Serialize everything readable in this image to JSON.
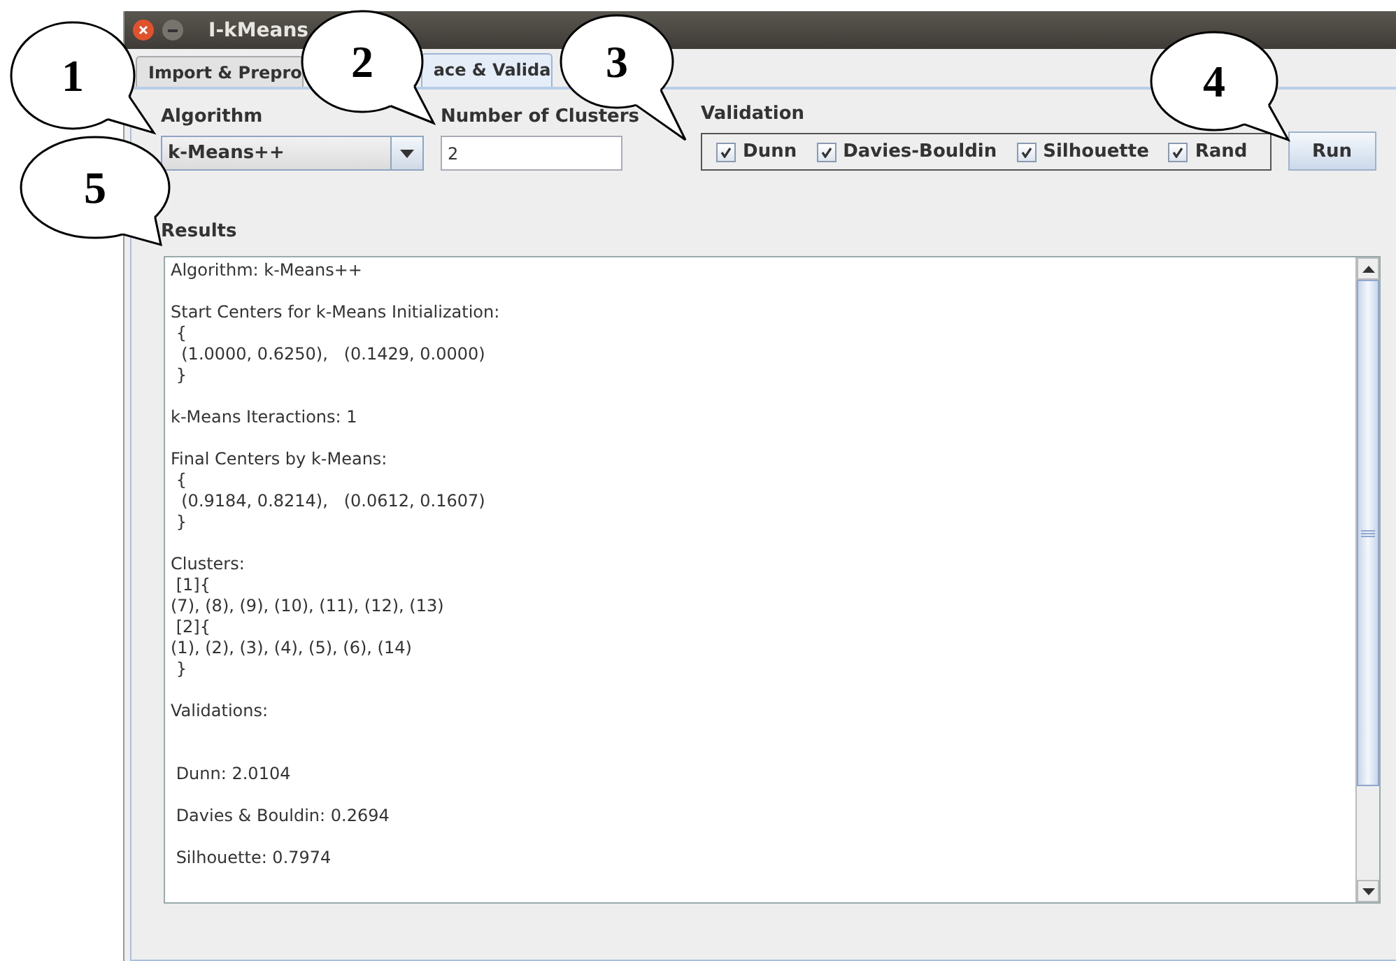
{
  "window": {
    "title": "I-kMeans"
  },
  "tabs": [
    {
      "label": "Import & Prepro",
      "selected": false
    },
    {
      "label": "ace & Valida",
      "selected": true
    }
  ],
  "algorithm": {
    "label": "Algorithm",
    "value": "k-Means++"
  },
  "clusters": {
    "label": "Number of Clusters",
    "value": "2"
  },
  "validation": {
    "label": "Validation",
    "options": [
      {
        "label": "Dunn",
        "checked": true
      },
      {
        "label": "Davies-Bouldin",
        "checked": true
      },
      {
        "label": "Silhouette",
        "checked": true
      },
      {
        "label": "Rand",
        "checked": true
      }
    ]
  },
  "run_button": "Run",
  "results": {
    "label": "Results",
    "blocks": [
      {
        "lines": [
          "Algorithm: k-Means++"
        ],
        "extra_space": false
      },
      {
        "lines": [
          "Start Centers for k-Means Initialization:",
          " {",
          "  (1.0000, 0.6250),   (0.1429, 0.0000)",
          " }"
        ],
        "extra_space": false
      },
      {
        "lines": [
          "k-Means Iteractions: 1"
        ],
        "extra_space": false
      },
      {
        "lines": [
          "Final Centers by k-Means:",
          " {",
          "  (0.9184, 0.8214),   (0.0612, 0.1607)",
          " }"
        ],
        "extra_space": false
      },
      {
        "lines": [
          "Clusters:",
          " [1]{",
          "(7), (8), (9), (10), (11), (12), (13)",
          " [2]{",
          "(1), (2), (3), (4), (5), (6), (14)",
          " }"
        ],
        "extra_space": false
      },
      {
        "lines": [
          "Validations:"
        ],
        "extra_space": false
      },
      {
        "lines": [
          " Dunn: 2.0104"
        ],
        "extra_space": true
      },
      {
        "lines": [
          " Davies & Bouldin: 0.2694"
        ],
        "extra_space": false
      },
      {
        "lines": [
          " Silhouette: 0.7974"
        ],
        "extra_space": false
      }
    ]
  },
  "callouts": [
    {
      "label": "1"
    },
    {
      "label": "2"
    },
    {
      "label": "3"
    },
    {
      "label": "4"
    },
    {
      "label": "5"
    }
  ]
}
